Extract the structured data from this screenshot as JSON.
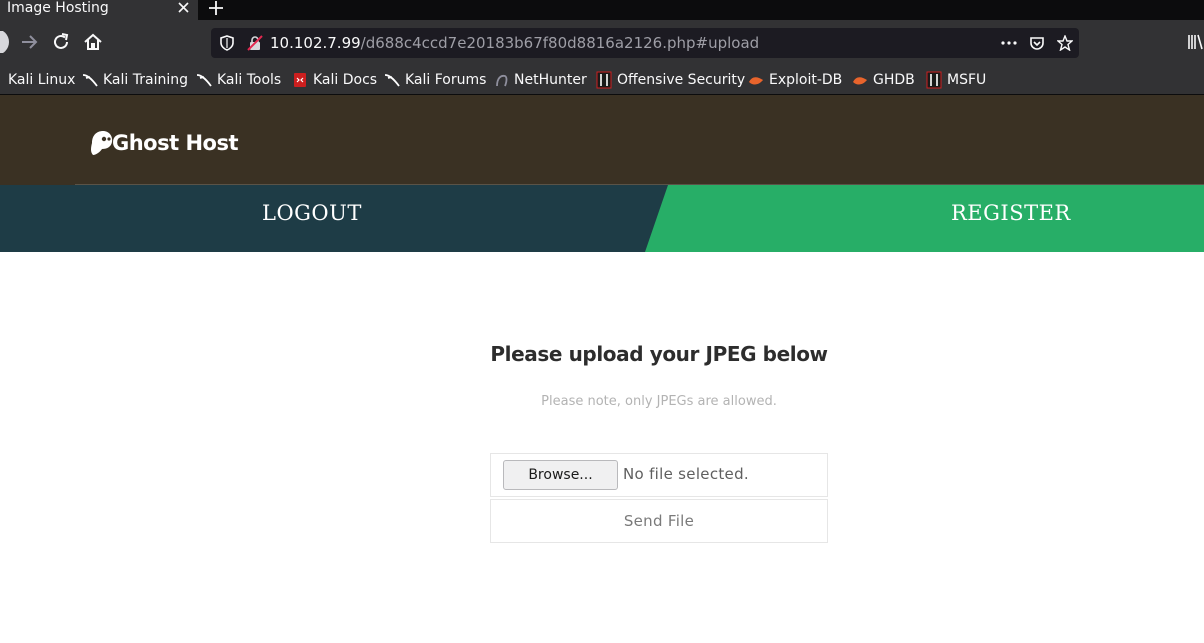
{
  "browser": {
    "tab_title": "Image Hosting",
    "url_host": "10.102.7.99",
    "url_path": "/d688c4ccd7e20183b67f80d8816a2126.php#upload",
    "bookmarks": [
      {
        "label": "Kali Linux",
        "icon": "kali-icon"
      },
      {
        "label": "Kali Training",
        "icon": "kali-dragon-icon"
      },
      {
        "label": "Kali Tools",
        "icon": "kali-dragon-icon"
      },
      {
        "label": "Kali Docs",
        "icon": "kali-docs-icon"
      },
      {
        "label": "Kali Forums",
        "icon": "kali-dragon-icon"
      },
      {
        "label": "NetHunter",
        "icon": "nethunter-icon"
      },
      {
        "label": "Offensive Security",
        "icon": "offsec-icon"
      },
      {
        "label": "Exploit-DB",
        "icon": "exploit-db-icon"
      },
      {
        "label": "GHDB",
        "icon": "ghdb-icon"
      },
      {
        "label": "MSFU",
        "icon": "msfu-icon"
      }
    ]
  },
  "site": {
    "logo_text": "Ghost Host",
    "nav": {
      "logout": "LOGOUT",
      "register": "REGISTER"
    }
  },
  "upload": {
    "heading": "Please upload your JPEG below",
    "note": "Please note, only JPEGs are allowed.",
    "browse_label": "Browse...",
    "file_status": "No file selected.",
    "send_label": "Send File"
  },
  "colors": {
    "header_bg": "#3a3123",
    "nav_left_bg": "#1e3c46",
    "nav_right_bg": "#27ae67",
    "browser_chrome": "#323234"
  }
}
